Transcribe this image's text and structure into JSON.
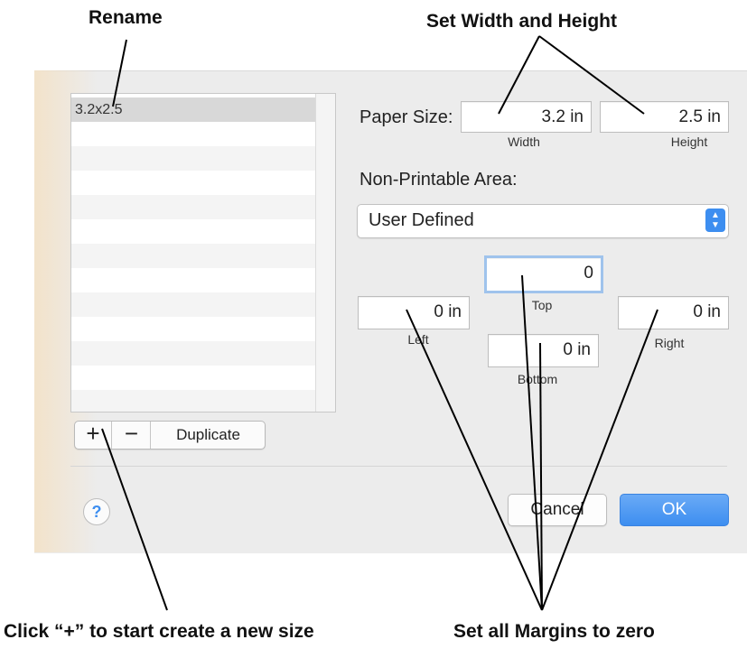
{
  "annotations": {
    "rename": "Rename",
    "set_width_height": "Set Width and Height",
    "click_plus": "Click “+” to start create a new size",
    "set_margins": "Set all Margins to zero"
  },
  "size_list": {
    "items": [
      "3.2x2.5"
    ]
  },
  "list_buttons": {
    "add": "+",
    "remove": "−",
    "duplicate": "Duplicate"
  },
  "paper_size": {
    "label": "Paper Size:",
    "width_value": "3.2 in",
    "width_label": "Width",
    "height_value": "2.5 in",
    "height_label": "Height"
  },
  "non_printable": {
    "label": "Non-Printable Area:",
    "selected": "User Defined"
  },
  "margins": {
    "top_value": "0",
    "top_label": "Top",
    "left_value": "0 in",
    "left_label": "Left",
    "right_value": "0 in",
    "right_label": "Right",
    "bottom_value": "0 in",
    "bottom_label": "Bottom"
  },
  "dialog_buttons": {
    "help": "?",
    "cancel": "Cancel",
    "ok": "OK"
  },
  "colors": {
    "accent": "#3d8ef0",
    "dialog_bg": "#ececec"
  }
}
